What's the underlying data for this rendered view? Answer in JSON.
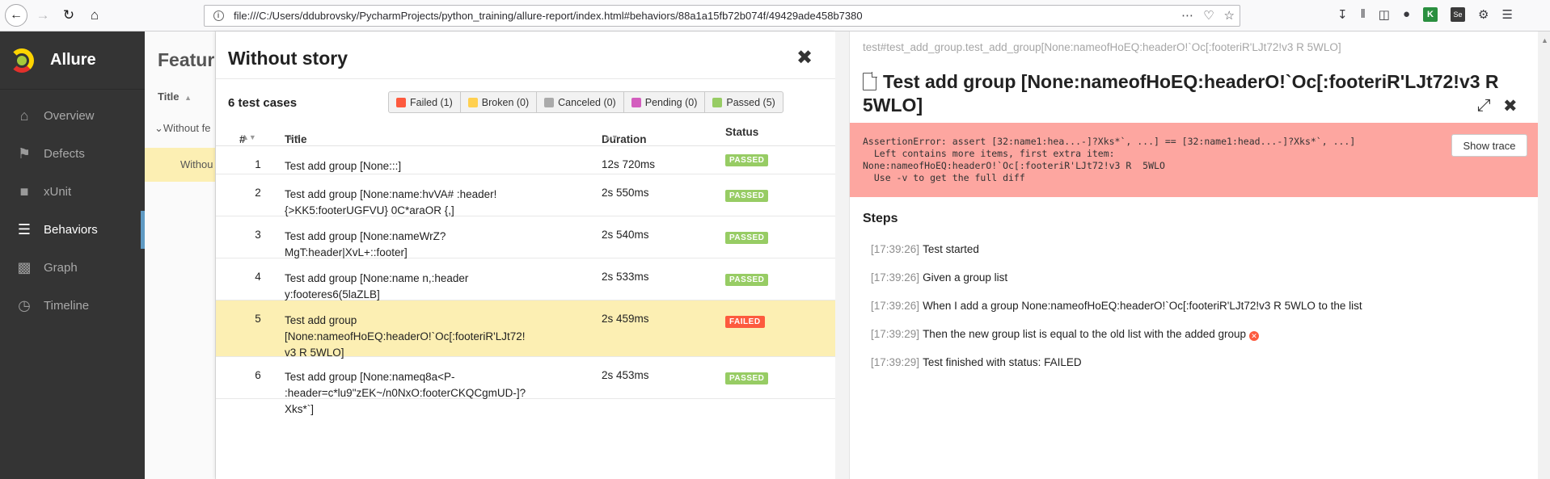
{
  "browser": {
    "url": "file:///C:/Users/ddubrovsky/PycharmProjects/python_training/allure-report/index.html#behaviors/88a1a15fb72b074f/49429ade458b7380"
  },
  "sidebar": {
    "brand": "Allure",
    "items": [
      {
        "label": "Overview",
        "icon": "home-icon"
      },
      {
        "label": "Defects",
        "icon": "flag-icon"
      },
      {
        "label": "xUnit",
        "icon": "briefcase-icon"
      },
      {
        "label": "Behaviors",
        "icon": "list-icon",
        "active": true
      },
      {
        "label": "Graph",
        "icon": "bar-chart-icon"
      },
      {
        "label": "Timeline",
        "icon": "clock-icon"
      }
    ]
  },
  "features": {
    "title": "Featur",
    "col_title": "Title",
    "row1": "Without fe",
    "row2": "Withou"
  },
  "middle": {
    "title": "Without story",
    "count": "6 test cases",
    "filters": [
      {
        "label": "Failed (1)",
        "color": "#fd5a3e"
      },
      {
        "label": "Broken (0)",
        "color": "#ffd050"
      },
      {
        "label": "Canceled (0)",
        "color": "#aaaaaa"
      },
      {
        "label": "Pending (0)",
        "color": "#d35ebe"
      },
      {
        "label": "Passed (5)",
        "color": "#97cc64"
      }
    ],
    "columns": {
      "num": "#",
      "title": "Title",
      "duration": "Duration",
      "status": "Status"
    },
    "rows": [
      {
        "num": "1",
        "title": "Test add group [None:::]",
        "duration": "12s 720ms",
        "status": "PASSED"
      },
      {
        "num": "2",
        "title": "Test add group [None:name:hvVA# :header!{>KK5:footerUGFVU} 0C*araOR {,]",
        "duration": "2s 550ms",
        "status": "PASSED"
      },
      {
        "num": "3",
        "title": "Test add group [None:nameWrZ?MgT:header|XvL+::footer]",
        "duration": "2s 540ms",
        "status": "PASSED"
      },
      {
        "num": "4",
        "title": "Test add group [None:name n,:header y:footeres6(5laZLB]",
        "duration": "2s 533ms",
        "status": "PASSED"
      },
      {
        "num": "5",
        "title": "Test add group [None:nameofHoEQ:headerO!`Oc[:footeriR'LJt72!v3 R 5WLO]",
        "duration": "2s 459ms",
        "status": "FAILED"
      },
      {
        "num": "6",
        "title": "Test add group [None:nameq8a<P- :header=c*lu9\"zEK~/n0NxO:footerCKQCgmUD-]?Xks*`]",
        "duration": "2s 453ms",
        "status": "PASSED"
      }
    ]
  },
  "detail": {
    "path": "test#test_add_group.test_add_group[None:nameofHoEQ:headerO!`Oc[:footeriR'LJt72!v3 R 5WLO]",
    "title": "Test add group [None:nameofHoEQ:headerO!`Oc[:footeriR'LJt72!v3 R 5WLO]",
    "error": "AssertionError: assert [32:name1:hea...-]?Xks*`, ...] == [32:name1:head...-]?Xks*`, ...]\n  Left contains more items, first extra item:\nNone:nameofHoEQ:headerO!`Oc[:footeriR'LJt72!v3 R  5WLO\n  Use -v to get the full diff",
    "show_trace": "Show trace",
    "steps_heading": "Steps",
    "steps": [
      {
        "time": "[17:39:26]",
        "text": "Test started"
      },
      {
        "time": "[17:39:26]",
        "text": "Given a group list"
      },
      {
        "time": "[17:39:26]",
        "text": "When I add a group None:nameofHoEQ:headerO!`Oc[:footeriR'LJt72!v3 R 5WLO to the list"
      },
      {
        "time": "[17:39:29]",
        "text": "Then the new group list is equal to the old list with the added group",
        "failed": true
      },
      {
        "time": "[17:39:29]",
        "text": "Test finished with status: FAILED"
      }
    ]
  }
}
